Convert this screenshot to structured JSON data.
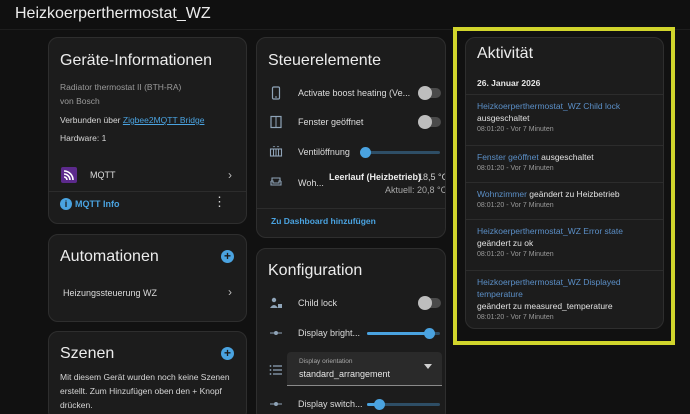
{
  "app": {
    "title": "Heizkoerperthermostat_WZ"
  },
  "device_info": {
    "title": "Geräte-Informationen",
    "model": "Radiator thermostat II (BTH-RA)",
    "manufacturer": "von Bosch",
    "connected_prefix": "Verbunden über",
    "connected_link": "Zigbee2MQTT Bridge",
    "hardware": "Hardware: 1",
    "integration_label": "MQTT",
    "info_link": "MQTT Info"
  },
  "automations": {
    "title": "Automationen",
    "items": [
      {
        "label": "Heizungssteuerung WZ"
      }
    ]
  },
  "scenes": {
    "title": "Szenen",
    "empty_text": "Mit diesem Gerät wurden noch keine Szenen erstellt. Zum Hinzufügen oben den + Knopf drücken."
  },
  "controls": {
    "title": "Steuerelemente",
    "boost_label": "Activate boost heating (Ve...",
    "boost_on": false,
    "window_label": "Fenster geöffnet",
    "window_on": false,
    "valve_label": "Ventilöffnung",
    "valve_level": 0.0,
    "climate_label": "Woh...",
    "climate_mode": "Leerlauf (Heizbetrieb)",
    "climate_target": "18,5 °C",
    "climate_current": "Aktuell: 20,8 °C",
    "add_dashboard": "Zu Dashboard hinzufügen"
  },
  "config": {
    "title": "Konfiguration",
    "child_lock_label": "Child lock",
    "child_lock_on": false,
    "brightness_label": "Display bright...",
    "brightness_level": 0.85,
    "orientation_label": "Display orientation",
    "orientation_value": "standard_arrangement",
    "switch_label": "Display switch...",
    "switch_level": 0.16
  },
  "activity": {
    "title": "Aktivität",
    "date": "26. Januar 2026",
    "entries": [
      {
        "entity": "Heizkoerperthermostat_WZ Child lock",
        "message": "ausgeschaltet",
        "time": "08:01:20 - Vor 7 Minuten"
      },
      {
        "entity": "Fenster geöffnet",
        "message": "ausgeschaltet",
        "time": "08:01:20 - Vor 7 Minuten"
      },
      {
        "entity": "Wohnzimmer",
        "message": "geändert zu Heizbetrieb",
        "time": "08:01:20 - Vor 7 Minuten"
      },
      {
        "entity": "Heizkoerperthermostat_WZ Error state",
        "message": "geändert zu ok",
        "time": "08:01:20 - Vor 7 Minuten"
      },
      {
        "entity": "Heizkoerperthermostat_WZ Displayed temperature",
        "message": "geändert zu measured_temperature",
        "time": "08:01:20 - Vor 7 Minuten"
      }
    ]
  },
  "colors": {
    "accent": "#4aa3e0",
    "highlight": "#d1d52c",
    "card": "#1c1c1c",
    "background": "#111111"
  }
}
